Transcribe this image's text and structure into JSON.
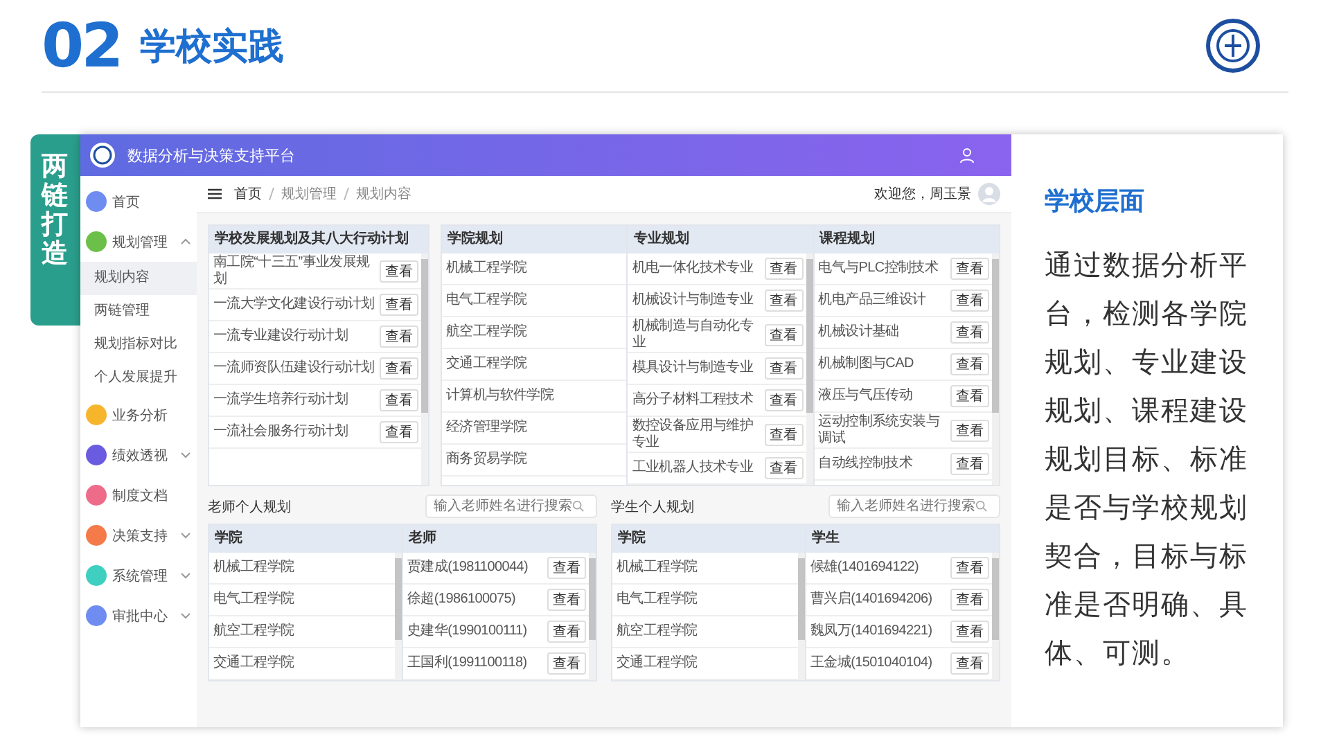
{
  "slide": {
    "number": "02",
    "title": "学校实践"
  },
  "side_tab": "两链打造",
  "app": {
    "title": "数据分析与决策支持平台",
    "greeting": "欢迎您，周玉景",
    "breadcrumbs": [
      "首页",
      "规划管理",
      "规划内容"
    ],
    "sidebar": [
      {
        "label": "首页",
        "kind": "link",
        "color": "#6f8cf0",
        "selected": false
      },
      {
        "label": "规划管理",
        "kind": "group",
        "color": "#6cc04a",
        "selected": false,
        "expanded": true,
        "children": [
          {
            "label": "规划内容",
            "selected": true
          },
          {
            "label": "两链管理",
            "selected": false
          },
          {
            "label": "规划指标对比",
            "selected": false
          },
          {
            "label": "个人发展提升",
            "selected": false
          }
        ]
      },
      {
        "label": "业务分析",
        "kind": "link",
        "color": "#f7b52c",
        "selected": false
      },
      {
        "label": "绩效透视",
        "kind": "group",
        "color": "#6b5be0",
        "selected": false,
        "expanded": false
      },
      {
        "label": "制度文档",
        "kind": "link",
        "color": "#ef6b8a",
        "selected": false
      },
      {
        "label": "决策支持",
        "kind": "group",
        "color": "#f47a4a",
        "selected": false,
        "expanded": false
      },
      {
        "label": "系统管理",
        "kind": "group",
        "color": "#3fcfc0",
        "selected": false,
        "expanded": false
      },
      {
        "label": "审批中心",
        "kind": "group",
        "color": "#6f8cf0",
        "selected": false,
        "expanded": false
      }
    ],
    "top_tables": [
      {
        "columns": [
          {
            "heading": "学校发展规划及其八大行动计划",
            "rows": [
              {
                "text": "南工院“十三五”事业发展规划",
                "button": "查看"
              },
              {
                "text": "一流大学文化建设行动计划",
                "button": "查看"
              },
              {
                "text": "一流专业建设行动计划",
                "button": "查看"
              },
              {
                "text": "一流师资队伍建设行动计划",
                "button": "查看"
              },
              {
                "text": "一流学生培养行动计划",
                "button": "查看"
              },
              {
                "text": "一流社会服务行动计划",
                "button": "查看"
              }
            ]
          }
        ]
      },
      {
        "columns": [
          {
            "heading": "学院规划",
            "rows": [
              {
                "text": "机械工程学院"
              },
              {
                "text": "电气工程学院"
              },
              {
                "text": "航空工程学院"
              },
              {
                "text": "交通工程学院"
              },
              {
                "text": "计算机与软件学院"
              },
              {
                "text": "经济管理学院"
              },
              {
                "text": "商务贸易学院"
              }
            ]
          },
          {
            "heading": "专业规划",
            "rows": [
              {
                "text": "机电一体化技术专业",
                "button": "查看"
              },
              {
                "text": "机械设计与制造专业",
                "button": "查看"
              },
              {
                "text": "机械制造与自动化专业",
                "button": "查看"
              },
              {
                "text": "模具设计与制造专业",
                "button": "查看"
              },
              {
                "text": "高分子材料工程技术",
                "button": "查看"
              },
              {
                "text": "数控设备应用与维护专业",
                "button": "查看"
              },
              {
                "text": "工业机器人技术专业",
                "button": "查看"
              }
            ]
          },
          {
            "heading": "课程规划",
            "rows": [
              {
                "text": "电气与PLC控制技术",
                "button": "查看"
              },
              {
                "text": "机电产品三维设计",
                "button": "查看"
              },
              {
                "text": "机械设计基础",
                "button": "查看"
              },
              {
                "text": "机械制图与CAD",
                "button": "查看"
              },
              {
                "text": "液压与气压传动",
                "button": "查看"
              },
              {
                "text": "运动控制系统安装与调试",
                "button": "查看"
              },
              {
                "text": "自动线控制技术",
                "button": "查看"
              }
            ]
          }
        ]
      }
    ],
    "sections": [
      {
        "title": "老师个人规划",
        "search": {
          "placeholder": "输入老师姓名进行搜索"
        },
        "columns": [
          {
            "heading": "学院",
            "rows": [
              {
                "text": "机械工程学院"
              },
              {
                "text": "电气工程学院"
              },
              {
                "text": "航空工程学院"
              },
              {
                "text": "交通工程学院"
              }
            ]
          },
          {
            "heading": "老师",
            "rows": [
              {
                "text": "贾建成(1981100044)",
                "button": "查看"
              },
              {
                "text": "徐超(1986100075)",
                "button": "查看"
              },
              {
                "text": "史建华(1990100111)",
                "button": "查看"
              },
              {
                "text": "王国利(1991100118)",
                "button": "查看"
              }
            ]
          }
        ]
      },
      {
        "title": "学生个人规划",
        "search": {
          "placeholder": "输入老师姓名进行搜索"
        },
        "columns": [
          {
            "heading": "学院",
            "rows": [
              {
                "text": "机械工程学院"
              },
              {
                "text": "电气工程学院"
              },
              {
                "text": "航空工程学院"
              },
              {
                "text": "交通工程学院"
              }
            ]
          },
          {
            "heading": "学生",
            "rows": [
              {
                "text": "候雄(1401694122)",
                "button": "查看"
              },
              {
                "text": "曹兴启(1401694206)",
                "button": "查看"
              },
              {
                "text": "魏凤万(1401694221)",
                "button": "查看"
              },
              {
                "text": "王金城(1501040104)",
                "button": "查看"
              }
            ]
          }
        ]
      }
    ]
  },
  "right_panel": {
    "heading": "学校层面",
    "body": "通过数据分析平台，检测各学院规划、专业建设规划、课程建设规划目标、标准是否与学校规划契合，目标与标准是否明确、具体、可测。"
  }
}
